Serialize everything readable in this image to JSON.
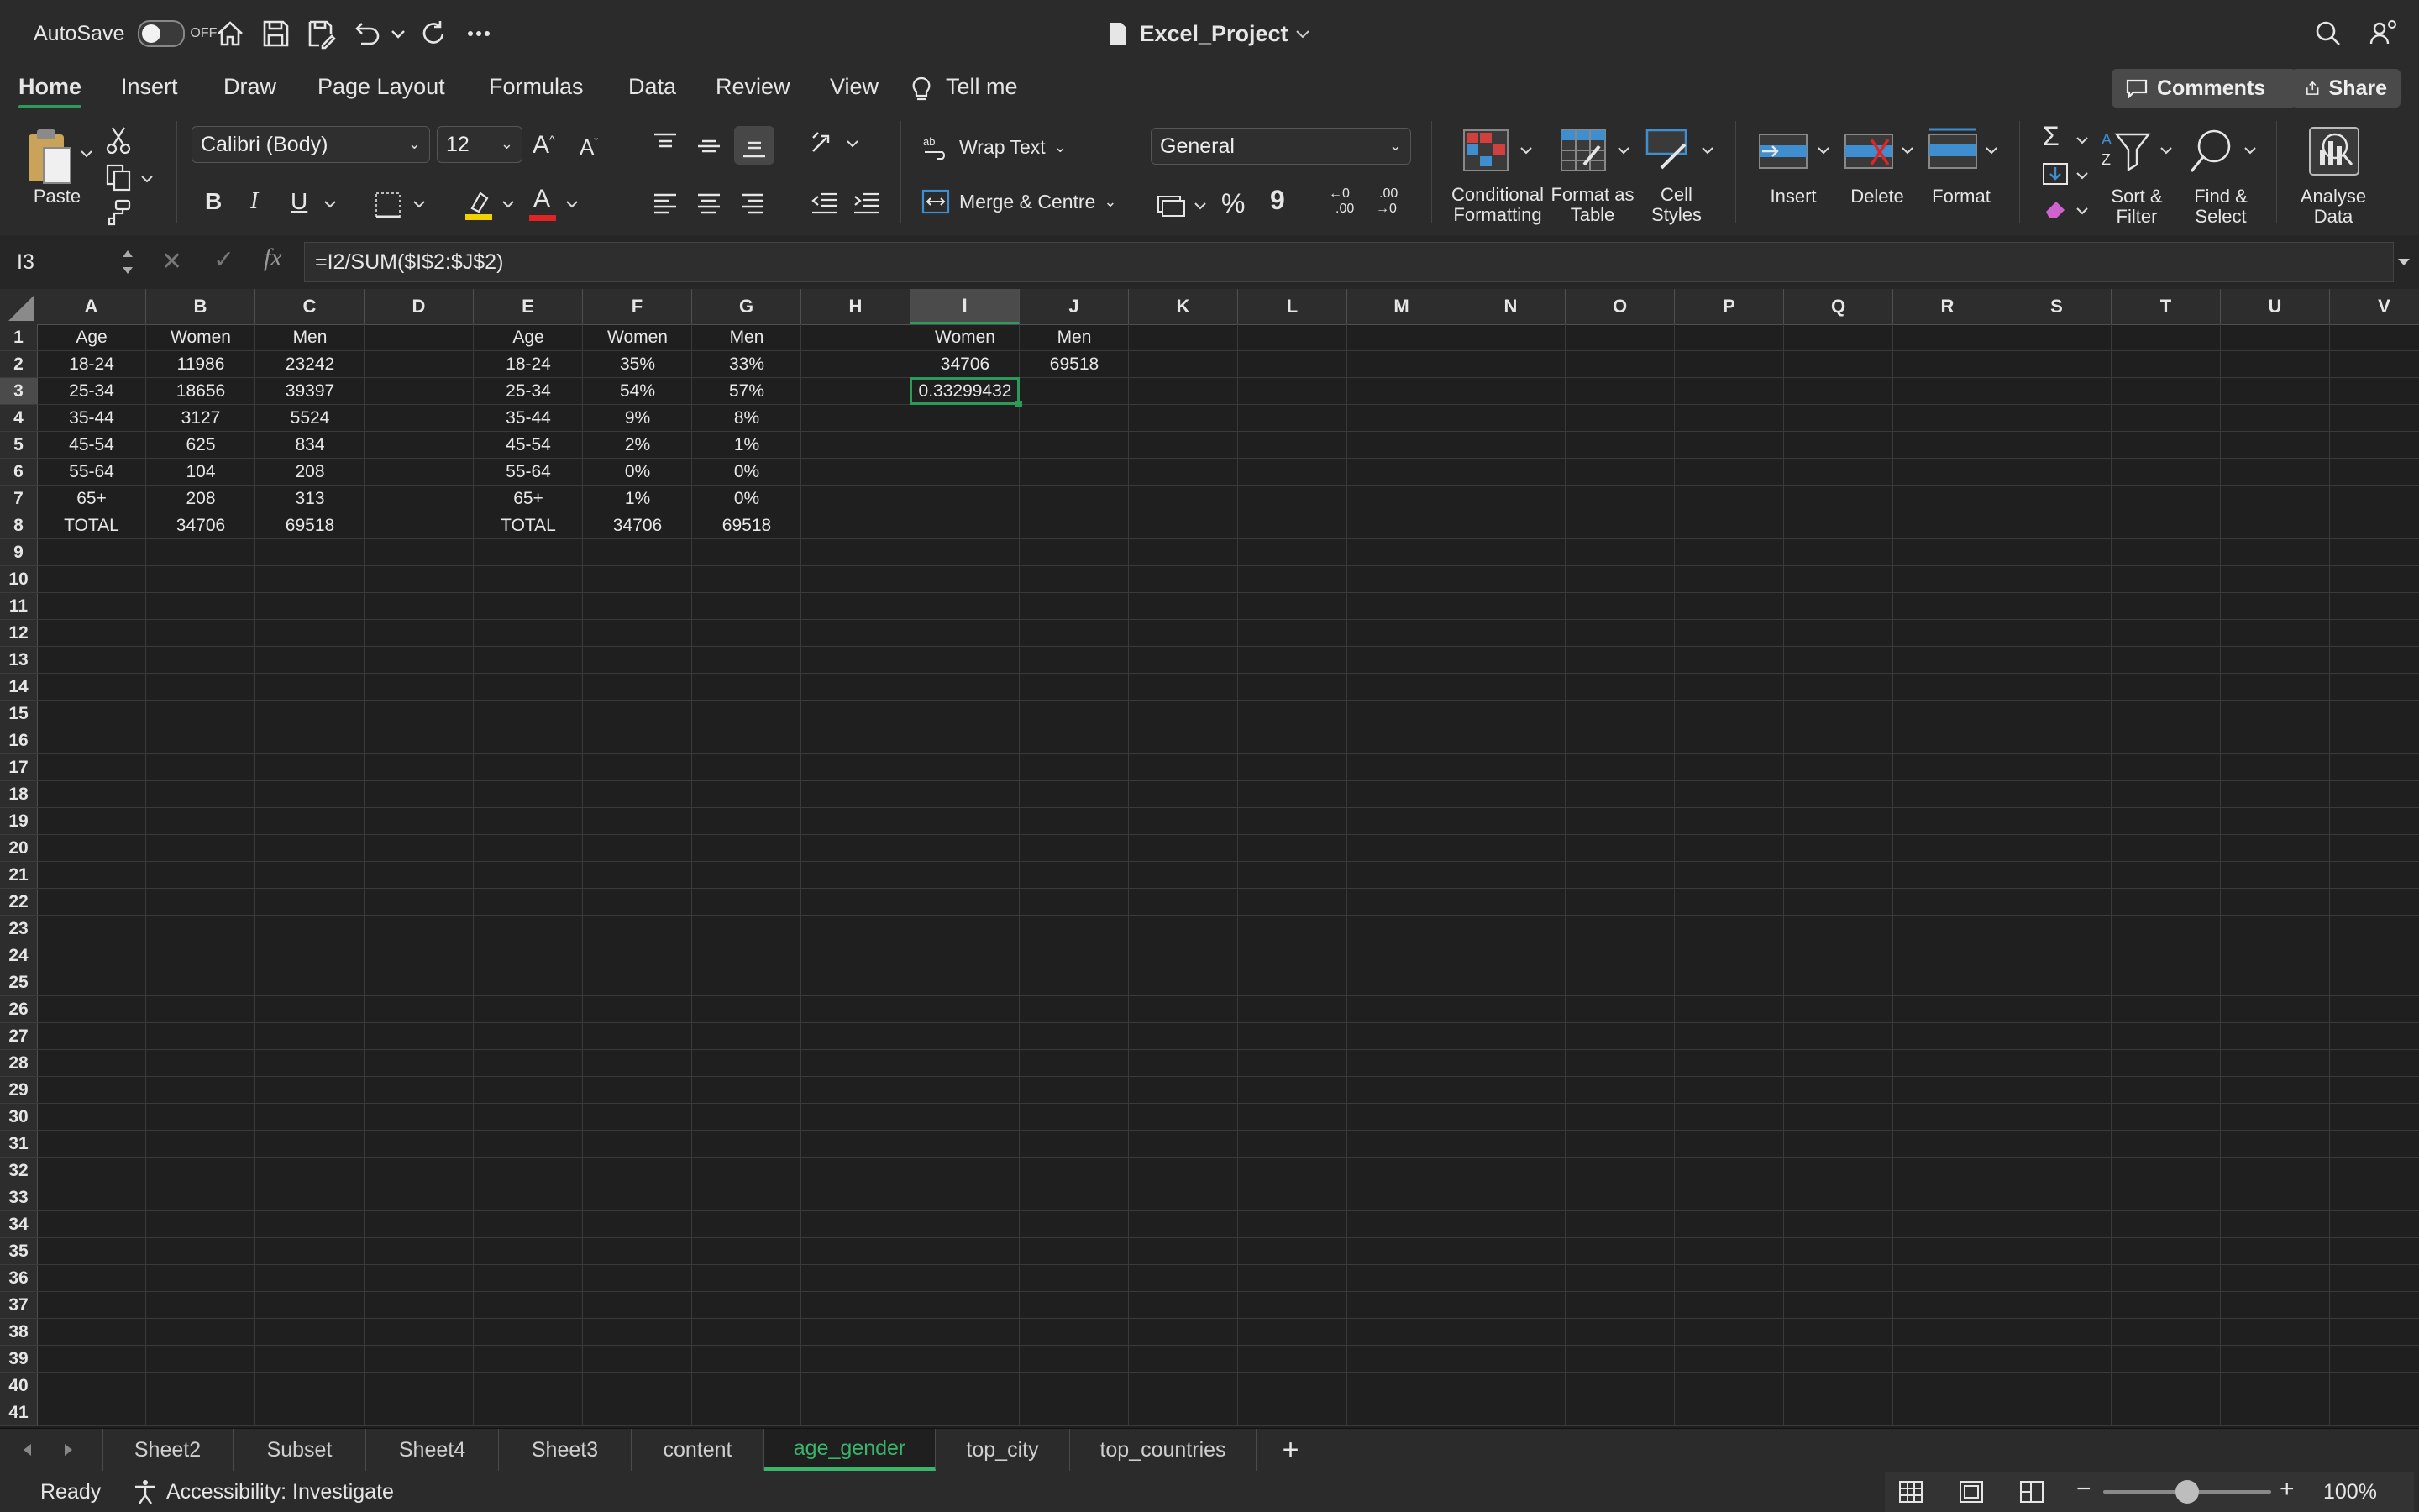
{
  "titlebar": {
    "autosave_label": "AutoSave",
    "autosave_state": "OFF",
    "document_title": "Excel_Project"
  },
  "ribbon_tabs": [
    "Home",
    "Insert",
    "Draw",
    "Page Layout",
    "Formulas",
    "Data",
    "Review",
    "View",
    "Tell me"
  ],
  "header_buttons": {
    "comments": "Comments",
    "share": "Share"
  },
  "ribbon": {
    "paste": "Paste",
    "font_name": "Calibri (Body)",
    "font_size": "12",
    "wrap_text": "Wrap Text",
    "merge_centre": "Merge & Centre",
    "number_format": "General",
    "conditional_formatting": "Conditional Formatting",
    "format_as_table": "Format as Table",
    "cell_styles": "Cell Styles",
    "insert": "Insert",
    "delete": "Delete",
    "format": "Format",
    "sort_filter": "Sort & Filter",
    "find_select": "Find & Select",
    "analyse_data": "Analyse Data",
    "bold": "B",
    "italic": "I",
    "underline": "U",
    "font_grow": "A",
    "font_shrink": "A",
    "font_color": "A",
    "percent": "%",
    "comma": "9",
    "inc_decimal": ".00",
    "dec_decimal": ".00",
    "sigma": "Σ",
    "accent_green": "#2e9a5a",
    "highlight_yellow": "#f2d100",
    "font_red": "#e02424"
  },
  "formula_bar": {
    "name_box": "I3",
    "fx": "fx",
    "formula": "=I2/SUM($I$2:$J$2)"
  },
  "grid": {
    "columns": [
      "A",
      "B",
      "C",
      "D",
      "E",
      "F",
      "G",
      "H",
      "I",
      "J",
      "K",
      "L",
      "M",
      "N",
      "O",
      "P",
      "Q",
      "R",
      "S",
      "T",
      "U",
      "V"
    ],
    "selected_column": "I",
    "rows": [
      "1",
      "2",
      "3",
      "4",
      "5",
      "6",
      "7",
      "8",
      "9",
      "10",
      "11",
      "12",
      "13",
      "14",
      "15",
      "16",
      "17",
      "18",
      "19",
      "20",
      "21",
      "22",
      "23",
      "24",
      "25",
      "26",
      "27",
      "28",
      "29",
      "30",
      "31",
      "32",
      "33",
      "34",
      "35",
      "36",
      "37",
      "38",
      "39",
      "40",
      "41"
    ],
    "selected_row": "3",
    "cells": [
      {
        "ref": "A1",
        "v": "Age"
      },
      {
        "ref": "B1",
        "v": "Women"
      },
      {
        "ref": "C1",
        "v": "Men"
      },
      {
        "ref": "E1",
        "v": "Age"
      },
      {
        "ref": "F1",
        "v": "Women"
      },
      {
        "ref": "G1",
        "v": "Men"
      },
      {
        "ref": "I1",
        "v": "Women"
      },
      {
        "ref": "J1",
        "v": "Men"
      },
      {
        "ref": "A2",
        "v": "18-24"
      },
      {
        "ref": "B2",
        "v": "11986"
      },
      {
        "ref": "C2",
        "v": "23242"
      },
      {
        "ref": "E2",
        "v": "18-24"
      },
      {
        "ref": "F2",
        "v": "35%"
      },
      {
        "ref": "G2",
        "v": "33%"
      },
      {
        "ref": "I2",
        "v": "34706"
      },
      {
        "ref": "J2",
        "v": "69518"
      },
      {
        "ref": "A3",
        "v": "25-34"
      },
      {
        "ref": "B3",
        "v": "18656"
      },
      {
        "ref": "C3",
        "v": "39397"
      },
      {
        "ref": "E3",
        "v": "25-34"
      },
      {
        "ref": "F3",
        "v": "54%"
      },
      {
        "ref": "G3",
        "v": "57%"
      },
      {
        "ref": "I3",
        "v": "0.33299432"
      },
      {
        "ref": "A4",
        "v": "35-44"
      },
      {
        "ref": "B4",
        "v": "3127"
      },
      {
        "ref": "C4",
        "v": "5524"
      },
      {
        "ref": "E4",
        "v": "35-44"
      },
      {
        "ref": "F4",
        "v": "9%"
      },
      {
        "ref": "G4",
        "v": "8%"
      },
      {
        "ref": "A5",
        "v": "45-54"
      },
      {
        "ref": "B5",
        "v": "625"
      },
      {
        "ref": "C5",
        "v": "834"
      },
      {
        "ref": "E5",
        "v": "45-54"
      },
      {
        "ref": "F5",
        "v": "2%"
      },
      {
        "ref": "G5",
        "v": "1%"
      },
      {
        "ref": "A6",
        "v": "55-64"
      },
      {
        "ref": "B6",
        "v": "104"
      },
      {
        "ref": "C6",
        "v": "208"
      },
      {
        "ref": "E6",
        "v": "55-64"
      },
      {
        "ref": "F6",
        "v": "0%"
      },
      {
        "ref": "G6",
        "v": "0%"
      },
      {
        "ref": "A7",
        "v": "65+"
      },
      {
        "ref": "B7",
        "v": "208"
      },
      {
        "ref": "C7",
        "v": "313"
      },
      {
        "ref": "E7",
        "v": "65+"
      },
      {
        "ref": "F7",
        "v": "1%"
      },
      {
        "ref": "G7",
        "v": "0%"
      },
      {
        "ref": "A8",
        "v": "TOTAL"
      },
      {
        "ref": "B8",
        "v": "34706"
      },
      {
        "ref": "C8",
        "v": "69518"
      },
      {
        "ref": "E8",
        "v": "TOTAL"
      },
      {
        "ref": "F8",
        "v": "34706"
      },
      {
        "ref": "G8",
        "v": "69518"
      }
    ],
    "active_cell": "I3"
  },
  "sheet_tabs": [
    "Sheet2",
    "Subset",
    "Sheet4",
    "Sheet3",
    "content",
    "age_gender",
    "top_city",
    "top_countries"
  ],
  "active_sheet": "age_gender",
  "add_sheet": "+",
  "status": {
    "ready": "Ready",
    "accessibility": "Accessibility: Investigate",
    "zoom": "100%",
    "zoom_level_fraction": 0.5
  }
}
